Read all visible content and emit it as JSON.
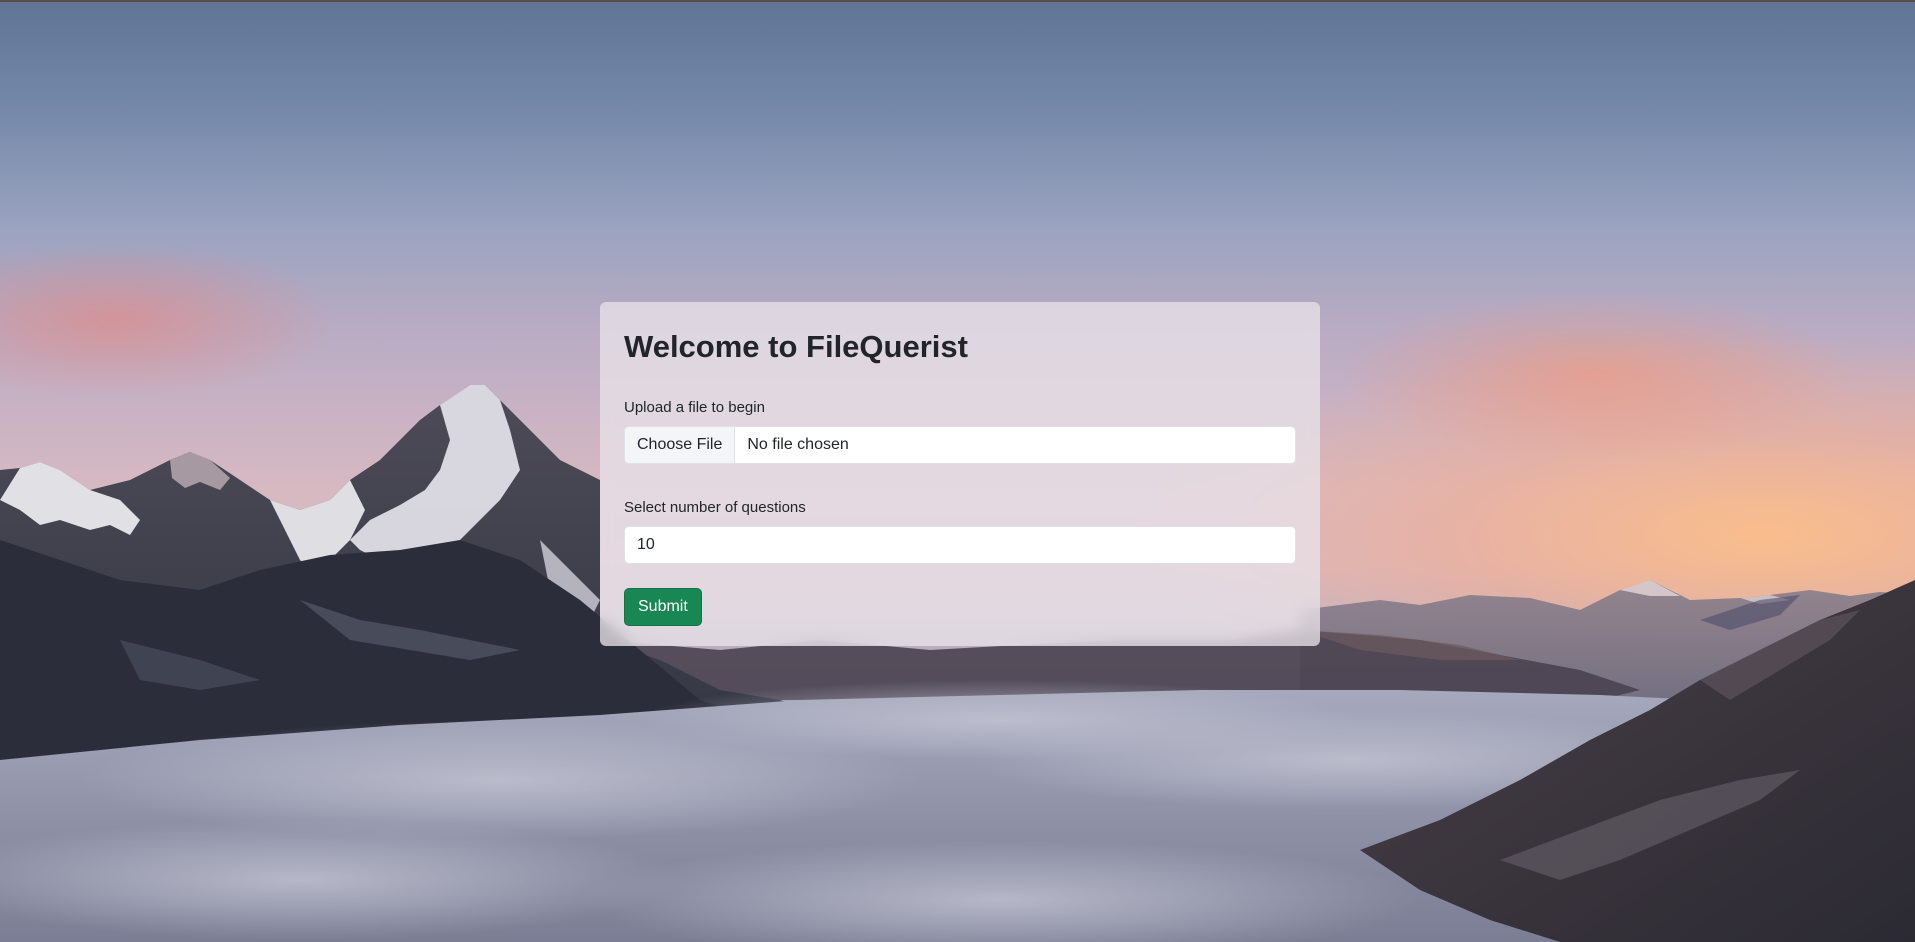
{
  "background": {
    "description_icon": "mountain-landscape-image"
  },
  "card": {
    "title": "Welcome to FileQuerist",
    "upload_label": "Upload a file to begin",
    "file_button_label": "Choose File",
    "file_status": "No file chosen",
    "questions_label": "Select number of questions",
    "questions_value": "10",
    "submit_label": "Submit"
  },
  "colors": {
    "submit_button": "#198754",
    "card_background": "rgba(232, 226, 232, 0.78)",
    "text": "#212529"
  }
}
